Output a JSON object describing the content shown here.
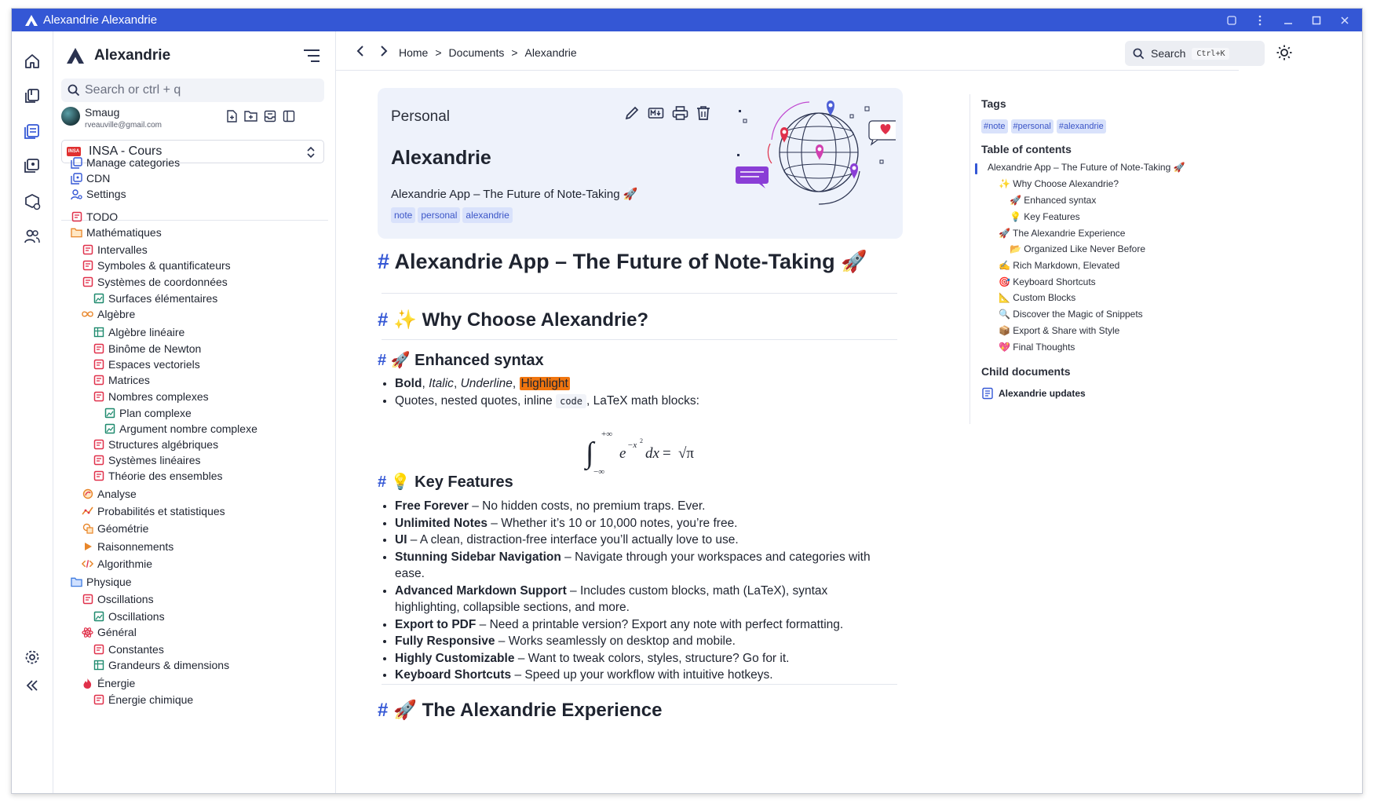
{
  "window": {
    "title": "Alexandrie Alexandrie"
  },
  "sidebar": {
    "workspace_name": "Alexandrie",
    "search_placeholder": "Search or ctrl + q",
    "user": {
      "name": "Smaug",
      "email": "rveauville@gmail.com"
    },
    "workspace_select": {
      "badge": "INSA",
      "label": "INSA - Cours"
    },
    "links": [
      {
        "label": "Manage categories",
        "icon": "categories-icon"
      },
      {
        "label": "CDN",
        "icon": "cdn-icon"
      },
      {
        "label": "Settings",
        "icon": "settings-icon"
      }
    ],
    "tree": [
      {
        "label": "TODO",
        "icon": "document-icon",
        "level": 0
      },
      {
        "label": "Mathématiques",
        "icon": "folder-icon",
        "level": 0
      },
      {
        "label": "Intervalles",
        "icon": "document-icon",
        "level": 1
      },
      {
        "label": "Symboles & quantificateurs",
        "icon": "document-icon",
        "level": 1
      },
      {
        "label": "Systèmes de coordonnées",
        "icon": "document-icon",
        "level": 1
      },
      {
        "label": "Surfaces élémentaires",
        "icon": "image-icon",
        "level": 2
      },
      {
        "label": "Algèbre",
        "icon": "infinity-icon",
        "level": 1
      },
      {
        "label": "Algèbre linéaire",
        "icon": "grid-icon",
        "level": 2
      },
      {
        "label": "Binôme de Newton",
        "icon": "document-icon",
        "level": 2
      },
      {
        "label": "Espaces vectoriels",
        "icon": "document-icon",
        "level": 2
      },
      {
        "label": "Matrices",
        "icon": "document-icon",
        "level": 2
      },
      {
        "label": "Nombres complexes",
        "icon": "document-icon",
        "level": 2
      },
      {
        "label": "Plan complexe",
        "icon": "image-icon",
        "level": 3
      },
      {
        "label": "Argument nombre complexe",
        "icon": "image-icon",
        "level": 3
      },
      {
        "label": "Structures algébriques",
        "icon": "document-icon",
        "level": 2
      },
      {
        "label": "Systèmes linéaires",
        "icon": "document-icon",
        "level": 2
      },
      {
        "label": "Théorie des ensembles",
        "icon": "document-icon",
        "level": 2
      },
      {
        "label": "Analyse",
        "icon": "analysis-icon",
        "level": 1
      },
      {
        "label": "Probabilités et statistiques",
        "icon": "stats-icon",
        "level": 1
      },
      {
        "label": "Géométrie",
        "icon": "geometry-icon",
        "level": 1
      },
      {
        "label": "Raisonnements",
        "icon": "play-icon",
        "level": 1
      },
      {
        "label": "Algorithmie",
        "icon": "code-icon",
        "level": 1
      },
      {
        "label": "Physique",
        "icon": "folder-blue-icon",
        "level": 0
      },
      {
        "label": "Oscillations",
        "icon": "document-icon",
        "level": 1
      },
      {
        "label": "Oscillations",
        "icon": "image-icon",
        "level": 2
      },
      {
        "label": "Général",
        "icon": "atom-icon",
        "level": 1
      },
      {
        "label": "Constantes",
        "icon": "document-icon",
        "level": 2
      },
      {
        "label": "Grandeurs & dimensions",
        "icon": "grid-icon",
        "level": 2
      },
      {
        "label": "Énergie",
        "icon": "fire-icon",
        "level": 1
      },
      {
        "label": "Énergie chimique",
        "icon": "document-icon",
        "level": 2
      }
    ]
  },
  "topbar": {
    "breadcrumbs": [
      "Home",
      "Documents",
      "Alexandrie"
    ],
    "separator": ">",
    "search_label": "Search",
    "search_shortcut": "Ctrl+K"
  },
  "card": {
    "category": "Personal",
    "title": "Alexandrie",
    "description": "Alexandrie App – The Future of Note-Taking 🚀",
    "tags": [
      "note",
      "personal",
      "alexandrie"
    ]
  },
  "content": {
    "hash": "#",
    "h1": "Alexandrie App – The Future of Note-Taking 🚀",
    "h2_why": "✨ Why Choose Alexandrie?",
    "h3_syntax": "🚀 Enhanced syntax",
    "syntax": {
      "bold": "Bold",
      "italic": "Italic",
      "underline": "Underline",
      "highlight": "Highlight",
      "quotes_pre": "Quotes, nested quotes, inline",
      "code": "code",
      "quotes_post": ", LaTeX math blocks:"
    },
    "math": {
      "upper": "+∞",
      "lower": "−∞",
      "integrand": "e",
      "exponent": "−x",
      "exponent_power": "2",
      "dx": "dx",
      "equals": "=",
      "sqrt": "√π"
    },
    "h3_features": "💡 Key Features",
    "features": [
      {
        "bold": "Free Forever",
        "text": " – No hidden costs, no premium traps. Ever."
      },
      {
        "bold": "Unlimited Notes",
        "text": " – Whether it’s 10 or 10,000 notes, you’re free."
      },
      {
        "bold": "UI",
        "text": " – A clean, distraction-free interface you’ll actually love to use."
      },
      {
        "bold": "Stunning Sidebar Navigation",
        "text": " – Navigate through your workspaces and categories with ease."
      },
      {
        "bold": "Advanced Markdown Support",
        "text": " – Includes custom blocks, math (LaTeX), syntax highlighting, collapsible sections, and more."
      },
      {
        "bold": "Export to PDF",
        "text": " – Need a printable version? Export any note with perfect formatting."
      },
      {
        "bold": "Fully Responsive",
        "text": " – Works seamlessly on desktop and mobile."
      },
      {
        "bold": "Highly Customizable",
        "text": " – Want to tweak colors, styles, structure? Go for it."
      },
      {
        "bold": "Keyboard Shortcuts",
        "text": " – Speed up your workflow with intuitive hotkeys."
      }
    ],
    "h2_experience": "🚀 The Alexandrie Experience"
  },
  "rpanel": {
    "tags_heading": "Tags",
    "tags": [
      "#note",
      "#personal",
      "#alexandrie"
    ],
    "toc_heading": "Table of contents",
    "toc": [
      {
        "label": "Alexandrie App – The Future of Note-Taking 🚀",
        "level": 0
      },
      {
        "label": "✨ Why Choose Alexandrie?",
        "level": 1
      },
      {
        "label": "🚀 Enhanced syntax",
        "level": 2
      },
      {
        "label": "💡 Key Features",
        "level": 2
      },
      {
        "label": "🚀 The Alexandrie Experience",
        "level": 1
      },
      {
        "label": "📂 Organized Like Never Before",
        "level": 2
      },
      {
        "label": "✍️ Rich Markdown, Elevated",
        "level": 1
      },
      {
        "label": "🎯 Keyboard Shortcuts",
        "level": 1
      },
      {
        "label": "📐 Custom Blocks",
        "level": 1
      },
      {
        "label": "🔍 Discover the Magic of Snippets",
        "level": 1
      },
      {
        "label": "📦 Export & Share with Style",
        "level": 1
      },
      {
        "label": "💖 Final Thoughts",
        "level": 1
      }
    ],
    "child_heading": "Child documents",
    "child_docs": [
      "Alexandrie updates"
    ]
  },
  "colors": {
    "accent": "#3457d5",
    "doc_red": "#e0304a",
    "image_green": "#1e8a6e",
    "folder_orange": "#e8862a",
    "highlight": "#f0750f"
  }
}
